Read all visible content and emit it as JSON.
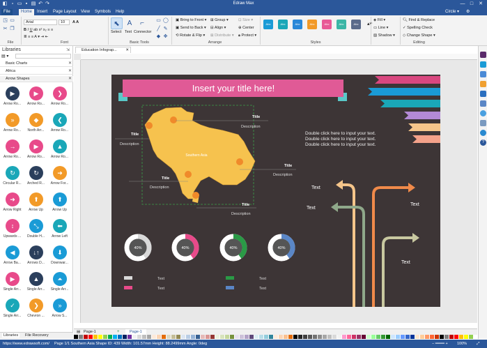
{
  "app": {
    "title": "Edraw Max",
    "quick_access": [
      "new-icon",
      "open-icon",
      "save-icon",
      "print-icon",
      "undo-icon",
      "redo-icon"
    ],
    "window_buttons": [
      "—",
      "□",
      "✕"
    ]
  },
  "menu": {
    "file": "File",
    "tabs": [
      "Home",
      "Insert",
      "Page Layout",
      "View",
      "Symbols",
      "Help"
    ],
    "active": "Home",
    "right": [
      "Circle"
    ]
  },
  "ribbon": {
    "file_group": "File",
    "font": {
      "family": "Arial",
      "size": "10",
      "label": "Font"
    },
    "basic_tools": {
      "label": "Basic Tools",
      "select": "Select",
      "text": "Text",
      "connector": "Connector"
    },
    "arrange": {
      "label": "Arrange",
      "items": [
        "Bring to Front",
        "Send to Back",
        "Rotate & Flip",
        "Group",
        "Align",
        "Distribute",
        "Size",
        "Center",
        "Protect"
      ]
    },
    "styles": {
      "label": "Styles",
      "swatch_text": "Abc",
      "swatches": [
        "#1a9bd6",
        "#1aa7b8",
        "#2a88d8",
        "#f29a28",
        "#e85a96",
        "#3bb6a6",
        "#5a6a8a"
      ]
    },
    "format": {
      "fill": "Fill",
      "line": "Line",
      "shadow": "Shadow"
    },
    "editing": {
      "label": "Editing",
      "items": [
        "Find & Replace",
        "Spelling Check",
        "Change Shape"
      ]
    }
  },
  "libraries": {
    "title": "Libraries",
    "sections": [
      "Basic Charts",
      "Africa",
      "Arrow Shapes"
    ],
    "shapes": [
      {
        "label": "Arrow Ro...",
        "color": "#2b3f5c",
        "glyph": "▶"
      },
      {
        "label": "Arrow Ro...",
        "color": "#e84a8a",
        "glyph": "▶"
      },
      {
        "label": "Arrow Ro...",
        "color": "#e84a8a",
        "glyph": "❯"
      },
      {
        "label": "Arrow Ro...",
        "color": "#f29a28",
        "glyph": "»"
      },
      {
        "label": "North Arr...",
        "color": "#f29a28",
        "glyph": "◆"
      },
      {
        "label": "Arrow Ro...",
        "color": "#1aa7b8",
        "glyph": "❮"
      },
      {
        "label": "Arrow Ro...",
        "color": "#e84a8a",
        "glyph": "→"
      },
      {
        "label": "Arrow Ro...",
        "color": "#e84a8a",
        "glyph": "▶"
      },
      {
        "label": "Arrow Ro...",
        "color": "#1aa7b8",
        "glyph": "▲"
      },
      {
        "label": "Circular R...",
        "color": "#1aa7b8",
        "glyph": "↻"
      },
      {
        "label": "Arched R...",
        "color": "#2b3f5c",
        "glyph": "↻"
      },
      {
        "label": "Arrow For...",
        "color": "#f29a28",
        "glyph": "➜"
      },
      {
        "label": "Arrow Right",
        "color": "#e84a8a",
        "glyph": "➜"
      },
      {
        "label": "Arrow Up",
        "color": "#f29a28",
        "glyph": "⬆"
      },
      {
        "label": "Arrow Up",
        "color": "#1a9bd6",
        "glyph": "⬆"
      },
      {
        "label": "Upwards ...",
        "color": "#e84a8a",
        "glyph": "↕"
      },
      {
        "label": "Double H...",
        "color": "#1a9bd6",
        "glyph": "⤡"
      },
      {
        "label": "Arrow Left",
        "color": "#1aa7b8",
        "glyph": "⬅"
      },
      {
        "label": "Arrow Ba...",
        "color": "#1a9bd6",
        "glyph": "◀"
      },
      {
        "label": "Arrows D...",
        "color": "#2b3f5c",
        "glyph": "↓↑"
      },
      {
        "label": "Downwar...",
        "color": "#1a9bd6",
        "glyph": "⬇"
      },
      {
        "label": "Single Arr...",
        "color": "#e84a8a",
        "glyph": "▶"
      },
      {
        "label": "Single Arr...",
        "color": "#2b3f5c",
        "glyph": "▲"
      },
      {
        "label": "Single Arr...",
        "color": "#1a9bd6",
        "glyph": "⏶"
      },
      {
        "label": "Single Arr...",
        "color": "#1aa7b8",
        "glyph": "✓"
      },
      {
        "label": "Chevron ...",
        "color": "#f29a28",
        "glyph": "❯"
      },
      {
        "label": "Arrow S...",
        "color": "#1a9bd6",
        "glyph": "»"
      }
    ],
    "bottom_tabs": [
      "Libraries",
      "File Recovery"
    ]
  },
  "document": {
    "tab": "Education Infograp..."
  },
  "infographic": {
    "title": "Insert your title here!",
    "map_label": "Southern Asia",
    "callouts": [
      {
        "title": "Title",
        "desc": "Description"
      },
      {
        "title": "Title",
        "desc": "Description"
      },
      {
        "title": "Title",
        "desc": "Description"
      },
      {
        "title": "Title",
        "desc": "Description"
      },
      {
        "title": "Title",
        "desc": "Description"
      }
    ],
    "paragraph": [
      "Double click here to input your text.",
      "Double click here to input your text.",
      "Double click here to input your text."
    ],
    "arrow_texts": [
      "Text",
      "Text",
      "Text",
      "Text"
    ],
    "donuts": [
      {
        "label": "40%",
        "color": "#d9d9d9",
        "value": 0.4
      },
      {
        "label": "40%",
        "color": "#e84a8a",
        "value": 0.4
      },
      {
        "label": "40%",
        "color": "#2a9a46",
        "value": 0.4
      },
      {
        "label": "40%",
        "color": "#5a86c6",
        "value": 0.4
      }
    ],
    "legend": [
      {
        "text": "Text",
        "color": "#d9d9d9"
      },
      {
        "text": "Text",
        "color": "#e84a8a"
      },
      {
        "text": "Text",
        "color": "#2a9a46"
      },
      {
        "text": "Text",
        "color": "#5a86c6"
      }
    ],
    "banners": [
      "#d9477f",
      "#1a9bd6",
      "#1aa7b8",
      "#b38ad6",
      "#f5c58a",
      "#f4a28a"
    ]
  },
  "pages": {
    "current": "Page-1",
    "tab": "Page-1"
  },
  "status": {
    "url": "https://www.edrawsoft.com/",
    "info": "Page 1/1  Southern Asia  Shape ID: 439  Width: 101.57mm  Height: 88.2499mm  Angle: 0deg",
    "zoom": "100%"
  }
}
